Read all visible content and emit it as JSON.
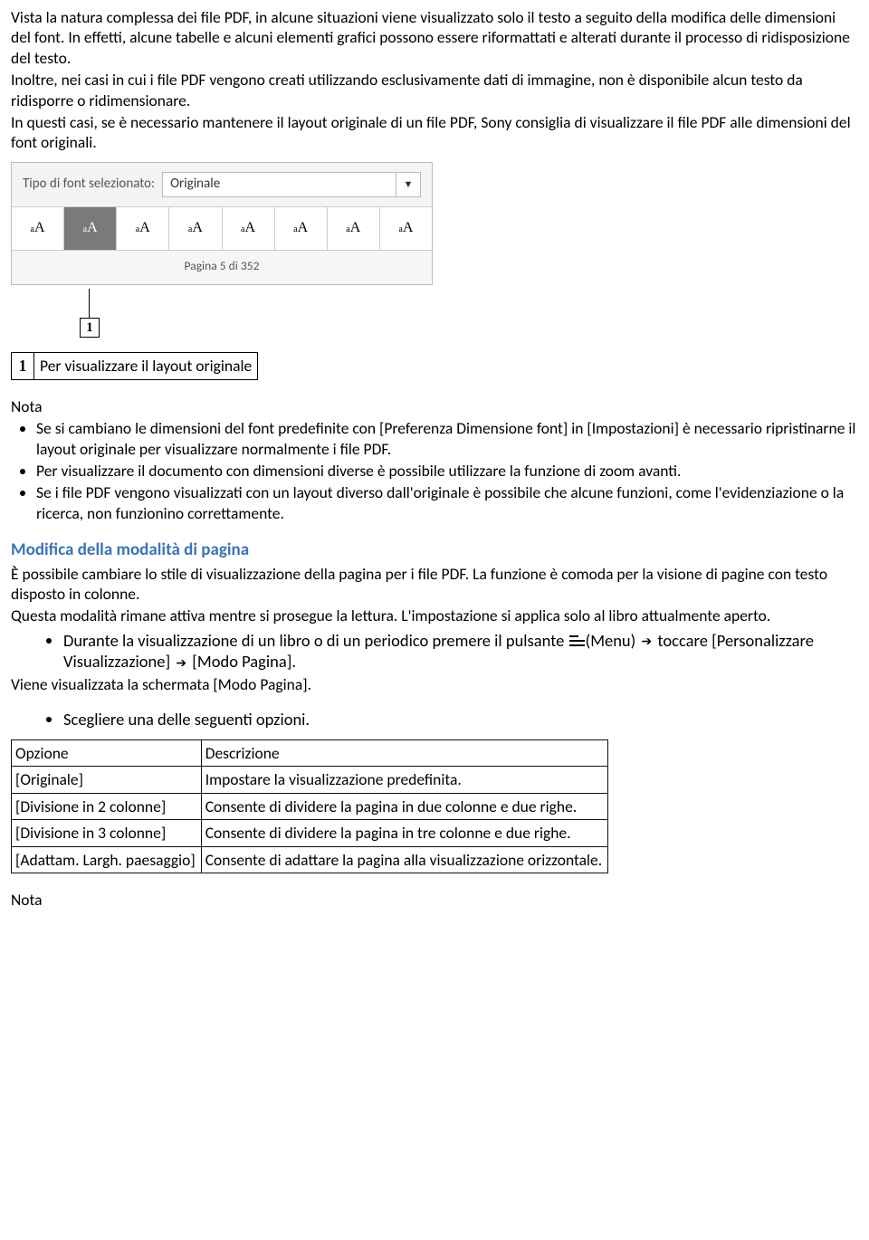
{
  "intro": {
    "p1": "Vista la natura complessa dei file PDF, in alcune situazioni viene visualizzato solo il testo a seguito della modifica delle dimensioni del font. In effetti, alcune tabelle e alcuni elementi grafici possono essere riformattati e alterati durante il processo di ridisposizione del testo.",
    "p2": "Inoltre, nei casi in cui i file PDF vengono creati utilizzando esclusivamente dati di immagine, non è disponibile alcun testo da ridisporre o ridimensionare.",
    "p3": "In questi casi, se è necessario mantenere il layout originale di un file PDF, Sony consiglia di visualizzare il file PDF alle dimensioni del font originali."
  },
  "fs": {
    "label": "Tipo di font selezionato:",
    "dd_value": "Originale",
    "page_status": "Pagina 5 di 352",
    "sizes": [
      "aA",
      "aA",
      "aA",
      "aA",
      "aA",
      "aA",
      "aA",
      "aA"
    ],
    "callout_num": "1"
  },
  "legend": {
    "num": "1",
    "text": "Per visualizzare il layout originale"
  },
  "nota1_label": "Nota",
  "nota1": {
    "b1": "Se si cambiano le dimensioni del font predefinite con [Preferenza Dimensione font] in [Impostazioni] è necessario ripristinarne il layout originale per visualizzare normalmente i file PDF.",
    "b2": "Per visualizzare il documento con dimensioni diverse è possibile utilizzare la funzione di zoom avanti.",
    "b3": "Se i file PDF vengono visualizzati con un layout diverso dall'originale è possibile che alcune funzioni, come l'evidenziazione o la ricerca, non funzionino correttamente."
  },
  "section2": {
    "title": "Modifica della modalità di pagina",
    "p1": "È possibile cambiare lo stile di visualizzazione della pagina per i file PDF. La funzione è comoda per la visione di pagine con testo disposto in colonne.",
    "p2": "Questa modalità rimane attiva mentre si prosegue la lettura. L'impostazione si applica solo al libro attualmente aperto.",
    "step1a": "Durante la visualizzazione di un libro o di un periodico premere il pulsante ",
    "step1b": "(Menu) ",
    "step1c": " toccare [Personalizzare Visualizzazione] ",
    "step1d": " [Modo Pagina].",
    "p3": "Viene visualizzata la schermata [Modo Pagina].",
    "step2": "Scegliere una delle seguenti opzioni."
  },
  "table": {
    "h1": "Opzione",
    "h2": "Descrizione",
    "rows": [
      {
        "o": "[Originale]",
        "d": "Impostare la visualizzazione predefinita."
      },
      {
        "o": "[Divisione in 2 colonne]",
        "d": "Consente di dividere la pagina in due colonne e due righe."
      },
      {
        "o": "[Divisione in 3 colonne]",
        "d": "Consente di dividere la pagina in tre colonne e due righe."
      },
      {
        "o": "[Adattam. Largh. paesaggio]",
        "d": "Consente di adattare la pagina alla visualizzazione orizzontale."
      }
    ]
  },
  "nota2_label": "Nota"
}
